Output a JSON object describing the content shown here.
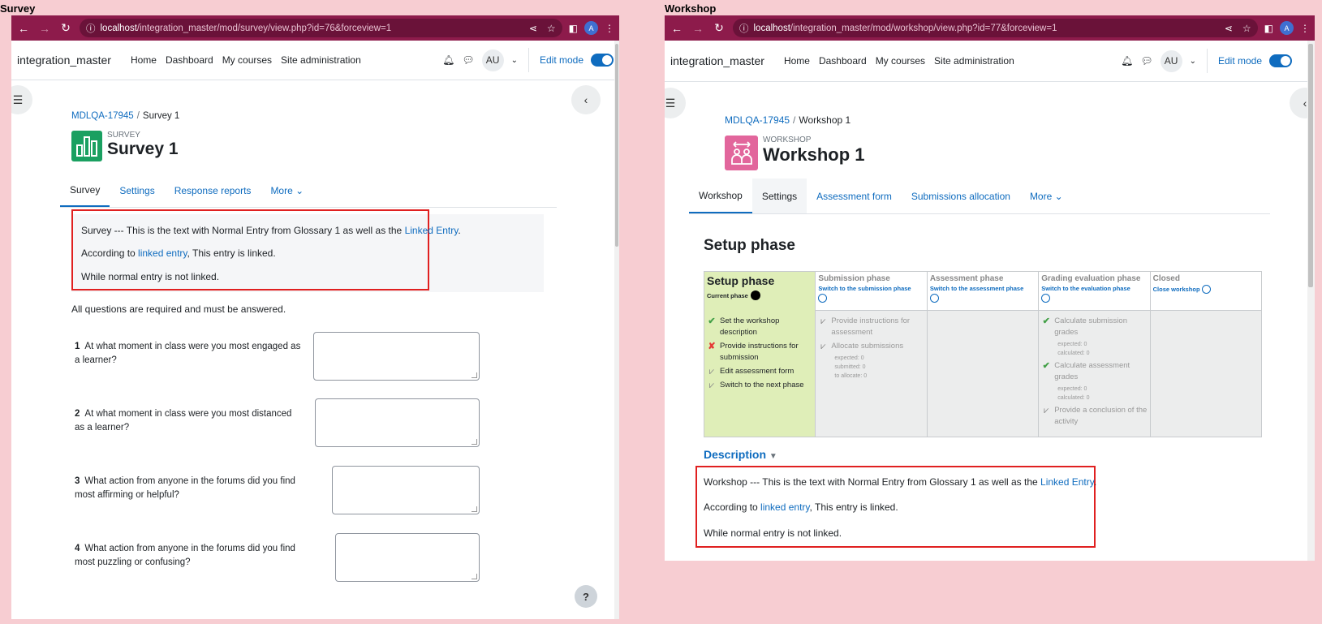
{
  "labels": {
    "left": "Survey",
    "right": "Workshop"
  },
  "left": {
    "url_host": "localhost",
    "url_path": "/integration_master/mod/survey/view.php?id=76&forceview=1",
    "profile_initial": "A",
    "site_name": "integration_master",
    "nav": [
      "Home",
      "Dashboard",
      "My courses",
      "Site administration"
    ],
    "user_initials": "AU",
    "edit_mode": "Edit mode",
    "breadcrumb": {
      "course": "MDLQA-17945",
      "current": "Survey 1"
    },
    "activity_type": "SURVEY",
    "title": "Survey 1",
    "tabs": [
      "Survey",
      "Settings",
      "Response reports",
      "More ⌄"
    ],
    "intro": {
      "line1_prefix": "Survey --- This is the text with Normal Entry from Glossary 1 as well as the ",
      "line1_link": "Linked Entry",
      "line1_suffix": ".",
      "line2_prefix": "According to ",
      "line2_link": "linked entry",
      "line2_suffix": ", This entry is linked.",
      "line3": "While normal entry is not linked."
    },
    "required_note": "All questions are required and must be answered.",
    "questions": [
      {
        "num": "1",
        "text": "At what moment in class were you most engaged as a learner?"
      },
      {
        "num": "2",
        "text": "At what moment in class were you most distanced as a learner?"
      },
      {
        "num": "3",
        "text": "What action from anyone in the forums did you find most affirming or helpful?"
      },
      {
        "num": "4",
        "text": "What action from anyone in the forums did you find most puzzling or confusing?"
      }
    ],
    "help": "?"
  },
  "right": {
    "url_host": "localhost",
    "url_path": "/integration_master/mod/workshop/view.php?id=77&forceview=1",
    "profile_initial": "A",
    "site_name": "integration_master",
    "nav": [
      "Home",
      "Dashboard",
      "My courses",
      "Site administration"
    ],
    "user_initials": "AU",
    "edit_mode": "Edit mode",
    "breadcrumb": {
      "course": "MDLQA-17945",
      "current": "Workshop 1"
    },
    "activity_type": "WORKSHOP",
    "title": "Workshop 1",
    "tabs": [
      "Workshop",
      "Settings",
      "Assessment form",
      "Submissions allocation",
      "More ⌄"
    ],
    "phase_heading": "Setup phase",
    "planner": {
      "setup": {
        "title": "Setup phase",
        "current": "Current phase",
        "tasks": [
          {
            "mark": "ok",
            "text": "Set the workshop description"
          },
          {
            "mark": "fail",
            "text": "Provide instructions for submission"
          },
          {
            "mark": "todo",
            "text": "Edit assessment form"
          },
          {
            "mark": "todo",
            "text": "Switch to the next phase"
          }
        ]
      },
      "submission": {
        "title": "Submission phase",
        "link": "Switch to the submission phase",
        "tasks": [
          {
            "mark": "todo",
            "text": "Provide instructions for assessment"
          },
          {
            "mark": "todo",
            "text": "Allocate submissions"
          }
        ],
        "details": [
          "expected: 0",
          "submitted: 0",
          "to allocate: 0"
        ]
      },
      "assessment": {
        "title": "Assessment phase",
        "link": "Switch to the assessment phase"
      },
      "grading": {
        "title": "Grading evaluation phase",
        "link": "Switch to the evaluation phase",
        "tasks": [
          {
            "mark": "ok",
            "text": "Calculate submission grades"
          },
          {
            "mark": "ok",
            "text": "Calculate assessment grades"
          },
          {
            "mark": "todo",
            "text": "Provide a conclusion of the activity"
          }
        ],
        "details1": [
          "expected: 0",
          "calculated: 0"
        ],
        "details2": [
          "expected: 0",
          "calculated: 0"
        ]
      },
      "closed": {
        "title": "Closed",
        "link": "Close workshop"
      }
    },
    "description_heading": "Description",
    "description": {
      "line1_prefix": "Workshop --- This is the text with Normal Entry from Glossary 1 as well as the ",
      "line1_link": "Linked Entry",
      "line1_suffix": ".",
      "line2_prefix": "According to ",
      "line2_link": "linked entry",
      "line2_suffix": ", This entry is linked.",
      "line3": "While normal entry is not linked."
    }
  }
}
